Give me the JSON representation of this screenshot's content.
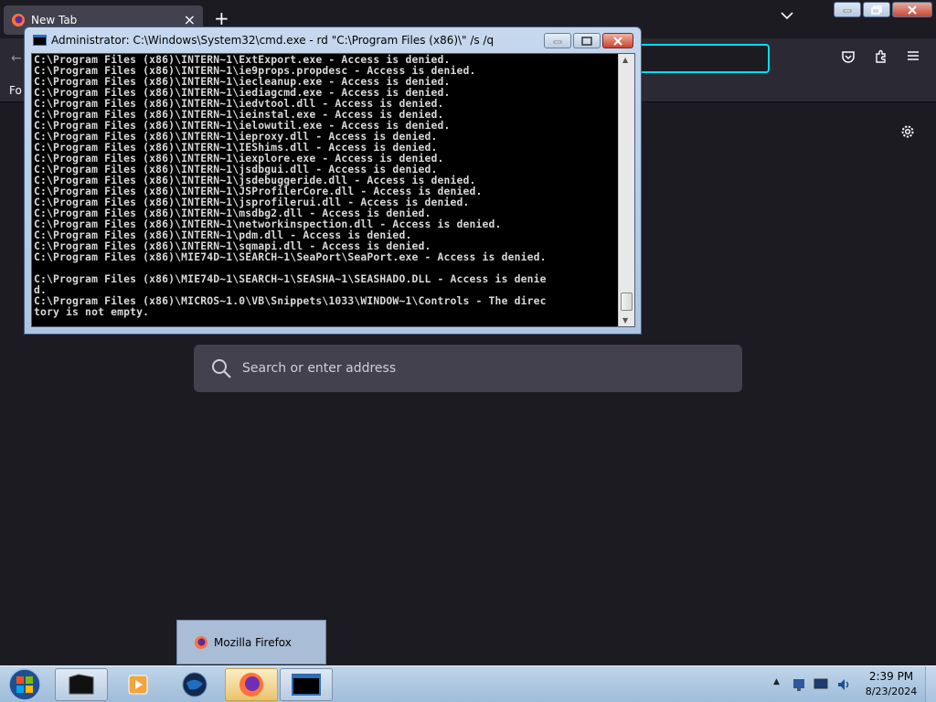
{
  "firefox": {
    "tab_title": "New Tab",
    "bookmarks_partial": "Fo",
    "search_placeholder": "Search or enter address"
  },
  "cmd": {
    "title": "Administrator: C:\\Windows\\System32\\cmd.exe - rd  \"C:\\Program Files (x86)\\\" /s /q",
    "lines": [
      "C:\\Program Files (x86)\\INTERN~1\\ExtExport.exe - Access is denied.",
      "C:\\Program Files (x86)\\INTERN~1\\ie9props.propdesc - Access is denied.",
      "C:\\Program Files (x86)\\INTERN~1\\iecleanup.exe - Access is denied.",
      "C:\\Program Files (x86)\\INTERN~1\\iediagcmd.exe - Access is denied.",
      "C:\\Program Files (x86)\\INTERN~1\\iedvtool.dll - Access is denied.",
      "C:\\Program Files (x86)\\INTERN~1\\ieinstal.exe - Access is denied.",
      "C:\\Program Files (x86)\\INTERN~1\\ielowutil.exe - Access is denied.",
      "C:\\Program Files (x86)\\INTERN~1\\ieproxy.dll - Access is denied.",
      "C:\\Program Files (x86)\\INTERN~1\\IEShims.dll - Access is denied.",
      "C:\\Program Files (x86)\\INTERN~1\\iexplore.exe - Access is denied.",
      "C:\\Program Files (x86)\\INTERN~1\\jsdbgui.dll - Access is denied.",
      "C:\\Program Files (x86)\\INTERN~1\\jsdebuggeride.dll - Access is denied.",
      "C:\\Program Files (x86)\\INTERN~1\\JSProfilerCore.dll - Access is denied.",
      "C:\\Program Files (x86)\\INTERN~1\\jsprofilerui.dll - Access is denied.",
      "C:\\Program Files (x86)\\INTERN~1\\msdbg2.dll - Access is denied.",
      "C:\\Program Files (x86)\\INTERN~1\\networkinspection.dll - Access is denied.",
      "C:\\Program Files (x86)\\INTERN~1\\pdm.dll - Access is denied.",
      "C:\\Program Files (x86)\\INTERN~1\\sqmapi.dll - Access is denied.",
      "C:\\Program Files (x86)\\MIE74D~1\\SEARCH~1\\SeaPort\\SeaPort.exe - Access is denied.",
      "",
      "C:\\Program Files (x86)\\MIE74D~1\\SEARCH~1\\SEASHA~1\\SEASHADO.DLL - Access is denie",
      "d.",
      "C:\\Program Files (x86)\\MICROS~1.0\\VB\\Snippets\\1033\\WINDOW~1\\Controls - The direc",
      "tory is not empty."
    ]
  },
  "taskbar": {
    "popup_label": "Mozilla Firefox",
    "time": "2:39 PM",
    "date": "8/23/2024"
  }
}
